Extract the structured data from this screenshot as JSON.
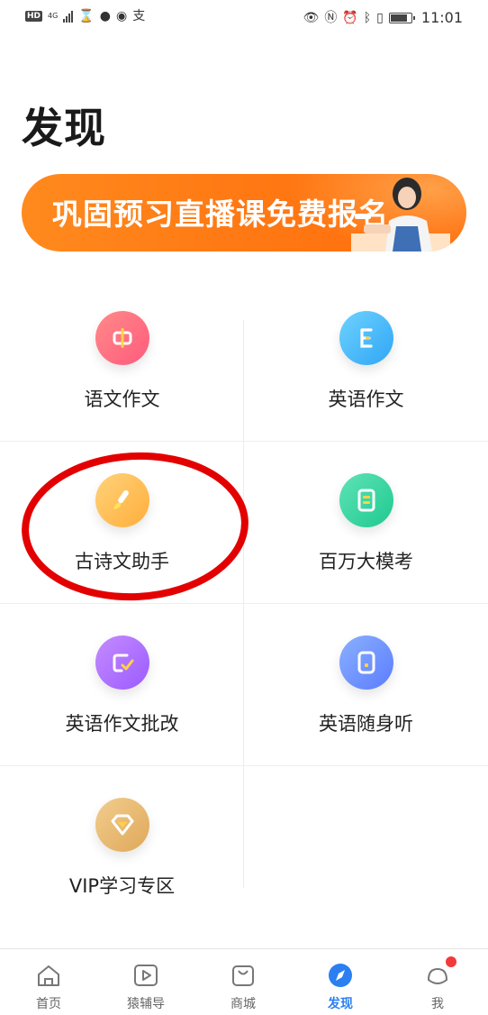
{
  "status_bar": {
    "hd": "HD",
    "network": "4G",
    "time": "11:01",
    "left_icons": [
      "hourglass-icon",
      "chat-bubble-icon",
      "wechat-icon",
      "alipay-icon"
    ],
    "right_icons": [
      "eye-icon",
      "nfc-icon",
      "alarm-icon",
      "bluetooth-icon",
      "vibrate-icon",
      "battery-icon"
    ],
    "battery_level": 0.85
  },
  "page": {
    "title": "发现"
  },
  "banner": {
    "text": "巩固预习直播课免费报名"
  },
  "features": [
    {
      "label": "语文作文",
      "icon": "chinese-zhong-icon",
      "color_start": "#ff8a8a",
      "color_end": "#ff5b7c"
    },
    {
      "label": "英语作文",
      "icon": "letter-e-icon",
      "color_start": "#6fd2ff",
      "color_end": "#2fa6f5"
    },
    {
      "label": "古诗文助手",
      "icon": "brush-icon",
      "color_start": "#ffd27a",
      "color_end": "#ffae3a"
    },
    {
      "label": "百万大模考",
      "icon": "exam-paper-icon",
      "color_start": "#5fe3b6",
      "color_end": "#1fc98f"
    },
    {
      "label": "英语作文批改",
      "icon": "check-document-icon",
      "color_start": "#c48cff",
      "color_end": "#9b5bff"
    },
    {
      "label": "英语随身听",
      "icon": "audio-player-icon",
      "color_start": "#8ab0ff",
      "color_end": "#5b7dff"
    },
    {
      "label": "VIP学习专区",
      "icon": "vip-diamond-icon",
      "color_start": "#f2cd8e",
      "color_end": "#dfa859"
    }
  ],
  "bottom_nav": [
    {
      "label": "首页",
      "icon": "home-icon",
      "active": false
    },
    {
      "label": "猿辅导",
      "icon": "play-icon",
      "active": false
    },
    {
      "label": "商城",
      "icon": "shopping-bag-icon",
      "active": false
    },
    {
      "label": "发现",
      "icon": "compass-icon",
      "active": true
    },
    {
      "label": "我",
      "icon": "profile-icon",
      "active": false
    }
  ],
  "colors": {
    "accent": "#2b7ff0",
    "banner": "#ff7a14",
    "annotation": "#e30000"
  }
}
